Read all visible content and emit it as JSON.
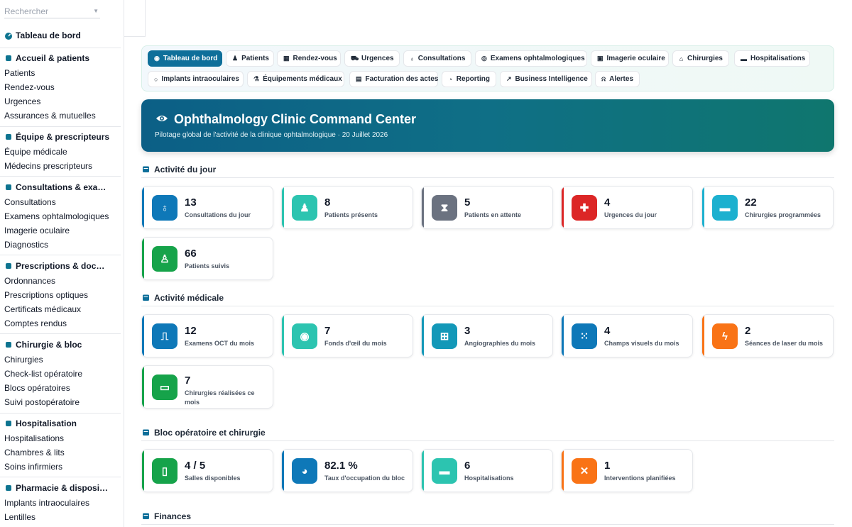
{
  "sidebar": {
    "search_placeholder": "Rechercher",
    "dashboard": "Tableau de bord",
    "sections": [
      {
        "title": "Accueil & patients",
        "icon": "user-group-icon",
        "items": [
          "Patients",
          "Rendez-vous",
          "Urgences",
          "Assurances & mutuelles"
        ]
      },
      {
        "title": "Équipe & prescripteurs",
        "icon": "user-doctor-icon",
        "items": [
          "Équipe médicale",
          "Médecins prescripteurs"
        ]
      },
      {
        "title": "Consultations & exa…",
        "icon": "stethoscope-icon",
        "items": [
          "Consultations",
          "Examens ophtalmologiques",
          "Imagerie oculaire",
          "Diagnostics"
        ]
      },
      {
        "title": "Prescriptions & doc…",
        "icon": "file-medical-icon",
        "items": [
          "Ordonnances",
          "Prescriptions optiques",
          "Certificats médicaux",
          "Comptes rendus"
        ]
      },
      {
        "title": "Chirurgie & bloc",
        "icon": "bed-icon",
        "items": [
          "Chirurgies",
          "Check-list opératoire",
          "Blocs opératoires",
          "Suivi postopératoire"
        ]
      },
      {
        "title": "Hospitalisation",
        "icon": "hospital-bed-icon",
        "items": [
          "Hospitalisations",
          "Chambres & lits",
          "Soins infirmiers"
        ]
      },
      {
        "title": "Pharmacie & disposi…",
        "icon": "pharmacy-icon",
        "items": [
          "Implants intraoculaires",
          "Lentilles"
        ]
      }
    ]
  },
  "nav": {
    "tabs": [
      {
        "label": "Tableau de bord",
        "icon": "◉",
        "active": true
      },
      {
        "label": "Patients",
        "icon": "♟",
        "active": false
      },
      {
        "label": "Rendez-vous",
        "icon": "▦",
        "active": false
      },
      {
        "label": "Urgences",
        "icon": "⛟",
        "active": false
      },
      {
        "label": "Consultations",
        "icon": "♁",
        "active": false
      },
      {
        "label": "Examens ophtalmologiques",
        "icon": "◎",
        "active": false
      },
      {
        "label": "Imagerie oculaire",
        "icon": "▣",
        "active": false
      },
      {
        "label": "Chirurgies",
        "icon": "⌂",
        "active": false
      },
      {
        "label": "Hospitalisations",
        "icon": "▬",
        "active": false
      },
      {
        "label": "Implants intraoculaires",
        "icon": "○",
        "active": false
      },
      {
        "label": "Équipements médicaux",
        "icon": "⚗",
        "active": false
      },
      {
        "label": "Facturation des actes",
        "icon": "▤",
        "active": false
      },
      {
        "label": "Reporting",
        "icon": "◔",
        "active": false
      },
      {
        "label": "Business Intelligence",
        "icon": "↗",
        "active": false
      },
      {
        "label": "Alertes",
        "icon": "⍾",
        "active": false
      }
    ]
  },
  "hero": {
    "title": "Ophthalmology Clinic Command Center",
    "subtitle": "Pilotage global de l'activité de la clinique ophtalmologique · 20 Juillet 2026"
  },
  "sections": [
    {
      "title": "Activité du jour",
      "icon": "calendar-icon",
      "cards": [
        {
          "value": "13",
          "label": "Consultations du jour",
          "color": "#0e78b8",
          "icon": "stethoscope-icon",
          "glyph": "♁"
        },
        {
          "value": "8",
          "label": "Patients présents",
          "color": "#2cc4b0",
          "icon": "user-check-icon",
          "glyph": "♟"
        },
        {
          "value": "5",
          "label": "Patients en attente",
          "color": "#6b7280",
          "icon": "hourglass-icon",
          "glyph": "⧗"
        },
        {
          "value": "4",
          "label": "Urgences du jour",
          "color": "#dc2626",
          "icon": "ambulance-icon",
          "glyph": "✚"
        },
        {
          "value": "22",
          "label": "Chirurgies programmées",
          "color": "#1cb0cf",
          "icon": "bed-icon",
          "glyph": "▬"
        },
        {
          "value": "66",
          "label": "Patients suivis",
          "color": "#16a34a",
          "icon": "user-nurse-icon",
          "glyph": "♙"
        }
      ]
    },
    {
      "title": "Activité médicale",
      "icon": "eye-icon",
      "cards": [
        {
          "value": "12",
          "label": "Examens OCT du mois",
          "color": "#0e78b8",
          "icon": "wave-square-icon",
          "glyph": "⎍"
        },
        {
          "value": "7",
          "label": "Fonds d'œil du mois",
          "color": "#2cc4b0",
          "icon": "eye-icon",
          "glyph": "◉"
        },
        {
          "value": "3",
          "label": "Angiographies du mois",
          "color": "#1398b8",
          "icon": "diagram-icon",
          "glyph": "⊞"
        },
        {
          "value": "4",
          "label": "Champs visuels du mois",
          "color": "#0e78b8",
          "icon": "grid-dots-icon",
          "glyph": "⁙"
        },
        {
          "value": "2",
          "label": "Séances de laser du mois",
          "color": "#f97316",
          "icon": "bolt-icon",
          "glyph": "ϟ"
        },
        {
          "value": "7",
          "label": "Chirurgies réalisées ce mois",
          "color": "#16a34a",
          "icon": "procedures-icon",
          "glyph": "▭"
        }
      ]
    },
    {
      "title": "Bloc opératoire et chirurgie",
      "icon": "building-icon",
      "cards": [
        {
          "value": "4 / 5",
          "label": "Salles disponibles",
          "color": "#16a34a",
          "icon": "door-open-icon",
          "glyph": "▯"
        },
        {
          "value": "82.1 %",
          "label": "Taux d'occupation du bloc",
          "color": "#0e78b8",
          "icon": "pie-chart-icon",
          "glyph": "◕"
        },
        {
          "value": "6",
          "label": "Hospitalisations",
          "color": "#2cc4b0",
          "icon": "bed-icon",
          "glyph": "▬"
        },
        {
          "value": "1",
          "label": "Interventions planifiées",
          "color": "#f97316",
          "icon": "tools-icon",
          "glyph": "✕"
        }
      ]
    },
    {
      "title": "Finances",
      "icon": "coins-icon",
      "cards": []
    }
  ]
}
